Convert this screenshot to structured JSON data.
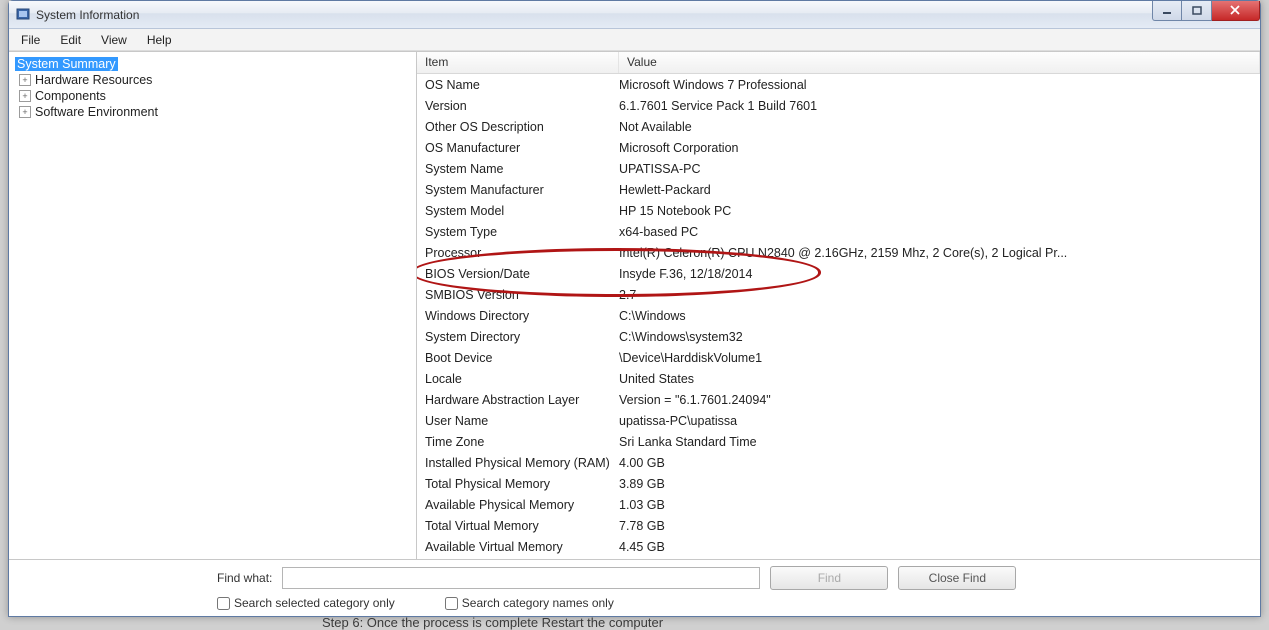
{
  "window": {
    "title": "System Information"
  },
  "menus": {
    "file": "File",
    "edit": "Edit",
    "view": "View",
    "help": "Help"
  },
  "tree": {
    "items": [
      {
        "label": "System Summary",
        "selected": true,
        "expandable": false
      },
      {
        "label": "Hardware Resources",
        "selected": false,
        "expandable": true
      },
      {
        "label": "Components",
        "selected": false,
        "expandable": true
      },
      {
        "label": "Software Environment",
        "selected": false,
        "expandable": true
      }
    ]
  },
  "list": {
    "headers": {
      "item": "Item",
      "value": "Value"
    },
    "rows": [
      {
        "item": "OS Name",
        "value": "Microsoft Windows 7 Professional"
      },
      {
        "item": "Version",
        "value": "6.1.7601 Service Pack 1 Build 7601"
      },
      {
        "item": "Other OS Description",
        "value": "Not Available"
      },
      {
        "item": "OS Manufacturer",
        "value": "Microsoft Corporation"
      },
      {
        "item": "System Name",
        "value": "UPATISSA-PC"
      },
      {
        "item": "System Manufacturer",
        "value": "Hewlett-Packard"
      },
      {
        "item": "System Model",
        "value": "HP 15 Notebook PC"
      },
      {
        "item": "System Type",
        "value": "x64-based PC"
      },
      {
        "item": "Processor",
        "value": "Intel(R) Celeron(R) CPU  N2840  @ 2.16GHz, 2159 Mhz, 2 Core(s), 2 Logical Pr..."
      },
      {
        "item": "BIOS Version/Date",
        "value": "Insyde F.36, 12/18/2014"
      },
      {
        "item": "SMBIOS Version",
        "value": "2.7"
      },
      {
        "item": "Windows Directory",
        "value": "C:\\Windows"
      },
      {
        "item": "System Directory",
        "value": "C:\\Windows\\system32"
      },
      {
        "item": "Boot Device",
        "value": "\\Device\\HarddiskVolume1"
      },
      {
        "item": "Locale",
        "value": "United States"
      },
      {
        "item": "Hardware Abstraction Layer",
        "value": "Version = \"6.1.7601.24094\""
      },
      {
        "item": "User Name",
        "value": "upatissa-PC\\upatissa"
      },
      {
        "item": "Time Zone",
        "value": "Sri Lanka Standard Time"
      },
      {
        "item": "Installed Physical Memory (RAM)",
        "value": "4.00 GB"
      },
      {
        "item": "Total Physical Memory",
        "value": "3.89 GB"
      },
      {
        "item": "Available Physical Memory",
        "value": "1.03 GB"
      },
      {
        "item": "Total Virtual Memory",
        "value": "7.78 GB"
      },
      {
        "item": "Available Virtual Memory",
        "value": "4.45 GB"
      }
    ]
  },
  "footer": {
    "find_label": "Find what:",
    "find_value": "",
    "find_btn": "Find",
    "close_btn": "Close Find",
    "cb1": "Search selected category only",
    "cb2": "Search category names only"
  },
  "annotation": {
    "highlighted_row_index": 9
  },
  "page_bottom_text": "Step 6: Once the process is complete  Restart the computer"
}
